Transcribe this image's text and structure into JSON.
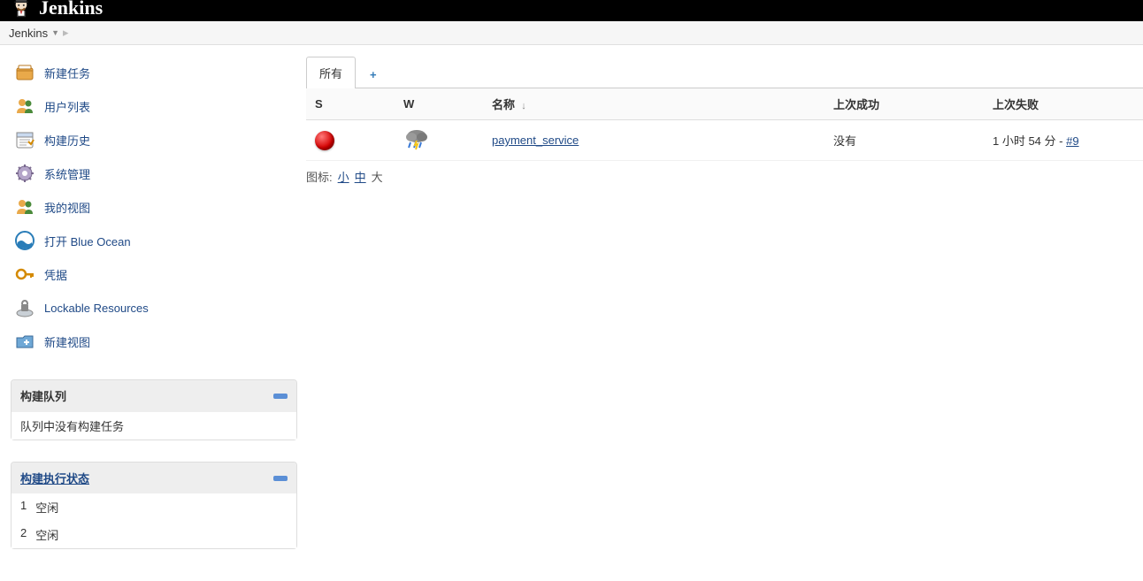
{
  "header": {
    "logo_text": "Jenkins"
  },
  "breadcrumb": {
    "items": [
      "Jenkins"
    ]
  },
  "sidebar": {
    "tasks": [
      {
        "label": "新建任务",
        "icon": "new-item"
      },
      {
        "label": "用户列表",
        "icon": "people"
      },
      {
        "label": "构建历史",
        "icon": "build-history"
      },
      {
        "label": "系统管理",
        "icon": "gear"
      },
      {
        "label": "我的视图",
        "icon": "my-views"
      },
      {
        "label": "打开 Blue Ocean",
        "icon": "blue-ocean"
      },
      {
        "label": "凭据",
        "icon": "credentials"
      },
      {
        "label": "Lockable Resources",
        "icon": "lock-resources"
      },
      {
        "label": "新建视图",
        "icon": "new-view"
      }
    ],
    "build_queue": {
      "title": "构建队列",
      "empty_text": "队列中没有构建任务"
    },
    "executors": {
      "title": "构建执行状态",
      "list": [
        {
          "num": "1",
          "status": "空闲"
        },
        {
          "num": "2",
          "status": "空闲"
        }
      ]
    }
  },
  "tabs": {
    "all": "所有"
  },
  "table": {
    "headers": {
      "status": "S",
      "weather": "W",
      "name": "名称",
      "last_success": "上次成功",
      "last_failure": "上次失败"
    },
    "rows": [
      {
        "name": "payment_service",
        "last_success": "没有",
        "last_failure_time": "1 小时 54 分 - ",
        "last_failure_build": "#9"
      }
    ]
  },
  "icon_size": {
    "label": "图标:",
    "small": "小",
    "medium": "中",
    "large": "大"
  }
}
